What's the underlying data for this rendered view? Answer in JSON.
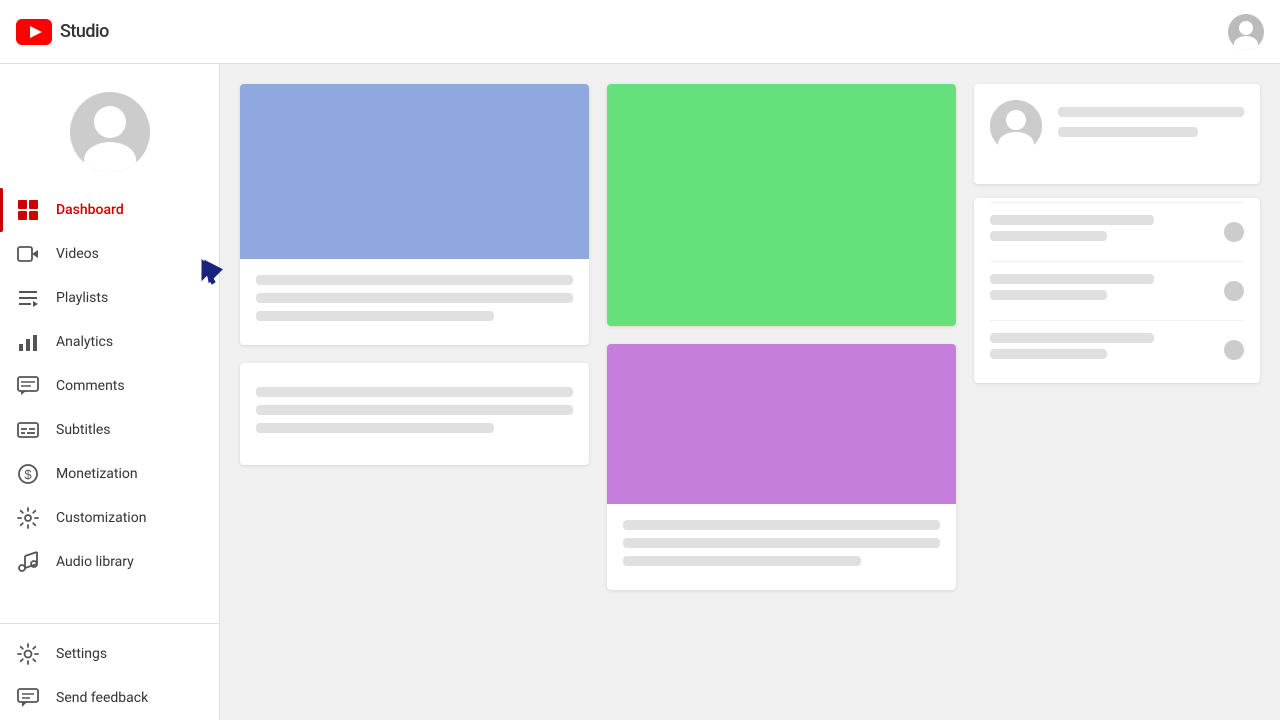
{
  "header": {
    "logo_alt": "YouTube Studio",
    "studio_label": "Studio"
  },
  "sidebar": {
    "nav_items": [
      {
        "id": "dashboard",
        "label": "Dashboard",
        "icon": "dashboard-icon",
        "active": true
      },
      {
        "id": "videos",
        "label": "Videos",
        "icon": "videos-icon",
        "active": false
      },
      {
        "id": "playlists",
        "label": "Playlists",
        "icon": "playlists-icon",
        "active": false
      },
      {
        "id": "analytics",
        "label": "Analytics",
        "icon": "analytics-icon",
        "active": false
      },
      {
        "id": "comments",
        "label": "Comments",
        "icon": "comments-icon",
        "active": false
      },
      {
        "id": "subtitles",
        "label": "Subtitles",
        "icon": "subtitles-icon",
        "active": false
      },
      {
        "id": "monetization",
        "label": "Monetization",
        "icon": "monetization-icon",
        "active": false
      },
      {
        "id": "customization",
        "label": "Customization",
        "icon": "customization-icon",
        "active": false
      },
      {
        "id": "audio-library",
        "label": "Audio library",
        "icon": "audio-library-icon",
        "active": false
      }
    ],
    "bottom_items": [
      {
        "id": "settings",
        "label": "Settings",
        "icon": "settings-icon"
      },
      {
        "id": "send-feedback",
        "label": "Send feedback",
        "icon": "feedback-icon"
      }
    ]
  },
  "main": {
    "card1": {
      "thumb_color": "#90a8e0"
    },
    "card2": {
      "thumb_color": "#66e07a"
    },
    "card3": {
      "thumb_color": "#c57edb"
    }
  },
  "colors": {
    "accent": "#cc0000",
    "sidebar_bg": "#ffffff",
    "main_bg": "#f0f0f0",
    "card_bg": "#ffffff",
    "placeholder": "#e0e0e0"
  }
}
